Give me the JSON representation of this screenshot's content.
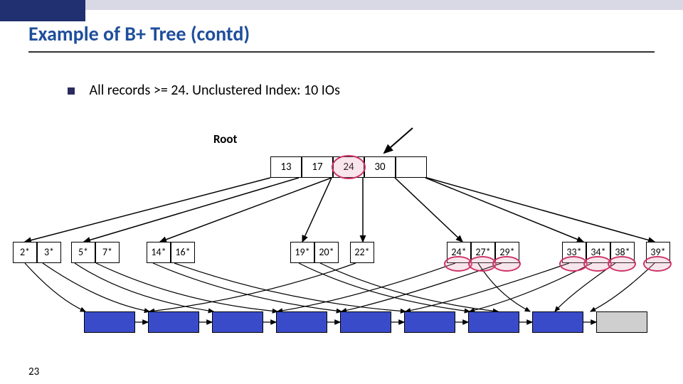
{
  "slide": {
    "title": "Example of B+ Tree (contd)",
    "bullet": "All records >= 24. Unclustered Index: 10 IOs",
    "root_label": "Root",
    "page_number": "23"
  },
  "tree": {
    "root_keys": [
      "13",
      "17",
      "24",
      "30"
    ],
    "leaves": [
      [
        "2*",
        "3*"
      ],
      [
        "5*",
        "7*"
      ],
      [
        "14*",
        "16*"
      ],
      [
        "19*",
        "20*"
      ],
      [
        "22*"
      ],
      [
        "24*",
        "27*",
        "29*"
      ],
      [
        "33*",
        "34*",
        "38*"
      ],
      [
        "39*"
      ]
    ]
  },
  "chart_data": {
    "type": "diagram",
    "structure": "B+ tree with 4-key root and 8 leaves; unclustered index range scan >=24 touching 10 pages",
    "root_keys": [
      13,
      17,
      24,
      30
    ],
    "leaf_nodes": [
      {
        "keys": [
          2,
          3
        ]
      },
      {
        "keys": [
          5,
          7
        ]
      },
      {
        "keys": [
          14,
          16
        ]
      },
      {
        "keys": [
          19,
          20
        ]
      },
      {
        "keys": [
          22
        ]
      },
      {
        "keys": [
          24,
          27,
          29
        ]
      },
      {
        "keys": [
          33,
          34,
          38
        ]
      },
      {
        "keys": [
          39
        ]
      }
    ],
    "highlighted_root_key": 24,
    "highlighted_leaf_keys": [
      24,
      27,
      29,
      33,
      34,
      38,
      39
    ],
    "io_count": 10
  }
}
